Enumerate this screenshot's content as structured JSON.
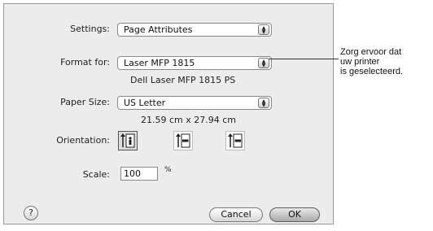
{
  "settings": {
    "label": "Settings:",
    "value": "Page Attributes"
  },
  "format_for": {
    "label": "Format for:",
    "value": "Laser MFP 1815",
    "detail": "Dell Laser MFP 1815 PS"
  },
  "paper_size": {
    "label": "Paper Size:",
    "value": "US Letter",
    "detail": "21.59 cm x 27.94 cm"
  },
  "orientation": {
    "label": "Orientation:",
    "options": [
      "portrait",
      "landscape",
      "reverse-landscape"
    ],
    "selected": "portrait"
  },
  "scale": {
    "label": "Scale:",
    "value": "100",
    "unit": "%"
  },
  "buttons": {
    "help": "?",
    "cancel": "Cancel",
    "ok": "OK"
  },
  "annotation": {
    "lines": [
      "Zorg ervoor dat",
      "uw printer",
      "is geselecteerd."
    ]
  }
}
